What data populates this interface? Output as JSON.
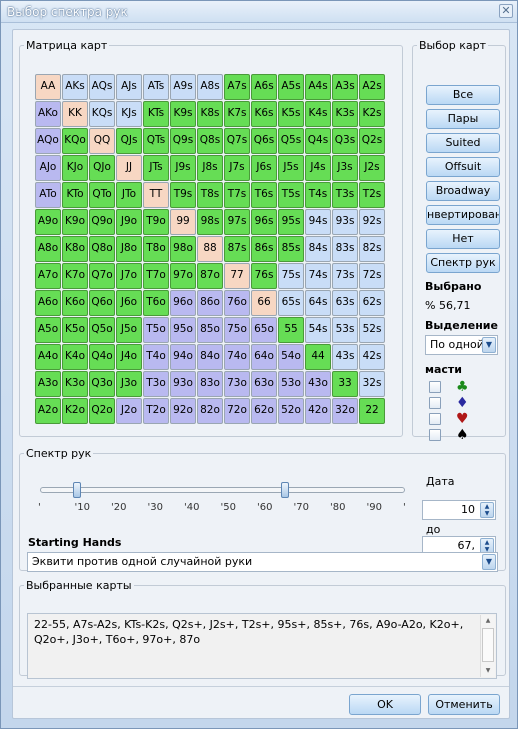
{
  "window": {
    "title": "Выбор спектра рук",
    "close_glyph": "✕"
  },
  "matrix_group": {
    "legend": "Матрица карт",
    "ranks": [
      "A",
      "K",
      "Q",
      "J",
      "T",
      "9",
      "8",
      "7",
      "6",
      "5",
      "4",
      "3",
      "2"
    ],
    "selected_rows": [
      [
        0,
        0,
        0,
        0,
        0,
        0,
        0,
        1,
        1,
        1,
        1,
        1,
        1
      ],
      [
        0,
        0,
        0,
        0,
        1,
        1,
        1,
        1,
        1,
        1,
        1,
        1,
        1
      ],
      [
        0,
        1,
        0,
        1,
        1,
        1,
        1,
        1,
        1,
        1,
        1,
        1,
        1
      ],
      [
        0,
        1,
        1,
        0,
        1,
        1,
        1,
        1,
        1,
        1,
        1,
        1,
        1
      ],
      [
        0,
        1,
        1,
        1,
        0,
        1,
        1,
        1,
        1,
        1,
        1,
        1,
        1
      ],
      [
        1,
        1,
        1,
        1,
        1,
        0,
        1,
        1,
        1,
        1,
        0,
        0,
        0
      ],
      [
        1,
        1,
        1,
        1,
        1,
        1,
        0,
        1,
        1,
        1,
        0,
        0,
        0
      ],
      [
        1,
        1,
        1,
        1,
        1,
        1,
        1,
        0,
        1,
        0,
        0,
        0,
        0
      ],
      [
        1,
        1,
        1,
        1,
        1,
        0,
        0,
        0,
        0,
        0,
        0,
        0,
        0
      ],
      [
        1,
        1,
        1,
        1,
        0,
        0,
        0,
        0,
        0,
        1,
        0,
        0,
        0
      ],
      [
        1,
        1,
        1,
        1,
        0,
        0,
        0,
        0,
        0,
        0,
        1,
        0,
        0
      ],
      [
        1,
        1,
        1,
        1,
        0,
        0,
        0,
        0,
        0,
        0,
        0,
        1,
        0
      ],
      [
        1,
        1,
        1,
        0,
        0,
        0,
        0,
        0,
        0,
        0,
        0,
        0,
        1
      ]
    ]
  },
  "select_group": {
    "legend": "Выбор карт",
    "buttons": [
      "Все",
      "Пары",
      "Suited",
      "Offsuit",
      "Broadway",
      "нвертирован",
      "Нет",
      "Спектр рук"
    ],
    "selected_label": "Выбрано",
    "selected_value": "% 56,71",
    "selection_label": "Выделение",
    "selection_mode": "По одной",
    "suits_label": "масти",
    "suits": [
      {
        "glyph": "♣",
        "color": "#1a8a1a"
      },
      {
        "glyph": "♦",
        "color": "#2a2aa0"
      },
      {
        "glyph": "♥",
        "color": "#b01818"
      },
      {
        "glyph": "♠",
        "color": "#000000"
      }
    ]
  },
  "range_group": {
    "legend": "Спектр рук",
    "ticks": [
      "'",
      "'10",
      "'20",
      "'30",
      "'40",
      "'50",
      "'60",
      "'70",
      "'80",
      "'90",
      "'"
    ],
    "from_label": "Дата",
    "from_value": "10",
    "to_label": "до",
    "to_value": "67,",
    "slider_low_pct": 10,
    "slider_high_pct": 67,
    "starting_hands_label": "Starting Hands",
    "equity_mode": "Эквити против одной случайной руки"
  },
  "cards_group": {
    "legend": "Выбранные карты",
    "text": "22-55, A7s-A2s, KTs-K2s, Q2s+, J2s+, T2s+, 95s+, 85s+, 76s, A9o-A2o, K2o+, Q2o+, J3o+, T6o+, 97o+, 87o"
  },
  "dialog": {
    "ok": "OK",
    "cancel": "Отменить"
  },
  "colors": {
    "pair": "#f7d7c3",
    "suited": "#c9ddf7",
    "offsuit": "#b9b9f0",
    "selected": "#66dd55"
  }
}
